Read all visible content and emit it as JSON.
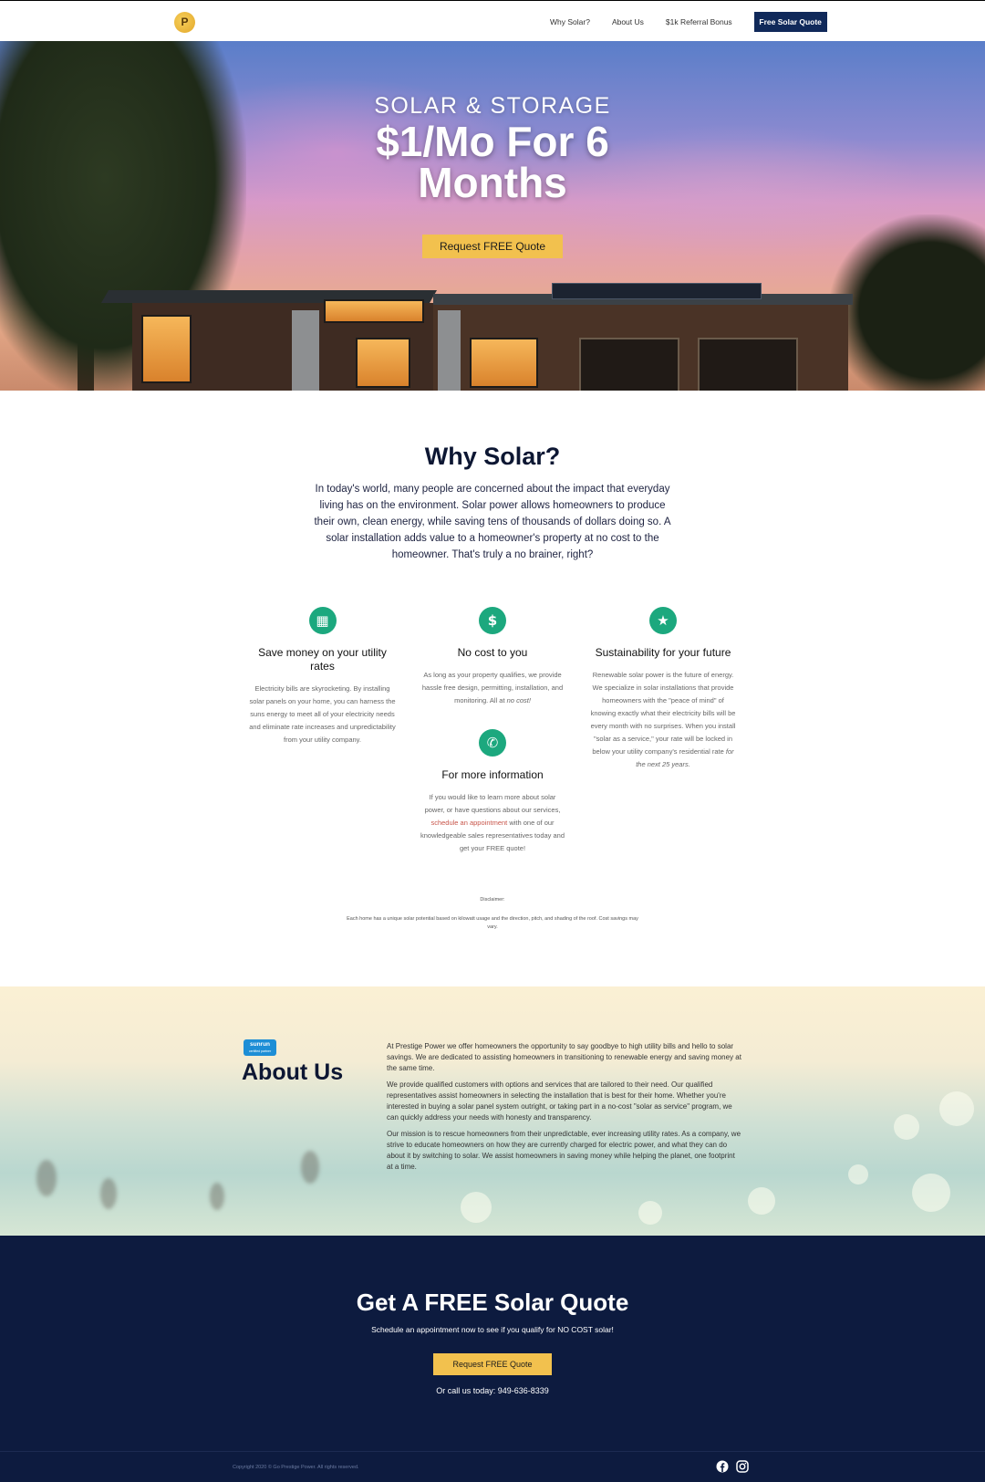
{
  "nav": {
    "logo_letter": "P",
    "links": [
      "Why Solar?",
      "About Us",
      "$1k Referral Bonus"
    ],
    "cta": "Free Solar Quote"
  },
  "hero": {
    "subtitle": "SOLAR & STORAGE",
    "title": "$1/Mo For 6 Months",
    "button": "Request FREE Quote"
  },
  "why": {
    "title": "Why Solar?",
    "text": "In today's world, many people are concerned about the impact that everyday living has on the environment. Solar power allows homeowners to produce their own, clean energy, while saving tens of thousands of dollars doing so. A solar installation adds value to a homeowner's property at no cost to the homeowner. That's truly a no brainer, right?"
  },
  "features": [
    {
      "icon": "solar-panel-icon",
      "title": "Save money on your utility rates",
      "text": "Electricity bills are skyrocketing. By installing solar panels on your home, you can harness the suns energy to meet all of your electricity needs and eliminate rate increases and unpredictability from your utility company."
    },
    {
      "icon": "dollar-icon",
      "title": "No cost to you",
      "text": "As long as your property qualifies, we provide hassle free design, permitting, installation, and monitoring. All at",
      "text_em": "no cost!"
    },
    {
      "icon": "star-icon",
      "title": "Sustainability for your future",
      "text": "Renewable solar power is the future of energy. We specialize in solar installations that provide homeowners with the \"peace of mind\" of knowing exactly what their electricity bills will be every month with no surprises. When you install \"solar as a service,\" your rate will be locked in below your utility company's residential rate",
      "text_em": "for the next 25 years."
    },
    {
      "icon": "phone-icon",
      "title": "For more information",
      "text_before": "If you would like to learn more about solar power, or have questions about our services,",
      "link": "schedule an appointment",
      "text_after": "with one of our knowledgeable sales representatives today and get your FREE quote!"
    }
  ],
  "disclaimer": {
    "label": "Disclaimer:",
    "text": "Each home has a unique solar potential based on kilowatt usage and the direction, pitch, and shading of the roof. Cost savings may vary."
  },
  "about": {
    "badge_line1": "sunrun",
    "badge_line2": "certified partner",
    "title": "About Us",
    "paragraphs": [
      "At Prestige Power we offer homeowners the opportunity to say goodbye to high utility bills and hello to solar savings. We are dedicated to assisting homeowners in transitioning to renewable energy and saving money at the same time.",
      "We provide qualified customers with options and services that are tailored to their need. Our qualified representatives assist homeowners in selecting the installation that is best for their home. Whether you're interested in buying a solar panel system outright, or taking part in a no-cost \"solar as service\" program, we can quickly address your needs with honesty and transparency.",
      "Our mission is to rescue homeowners from their unpredictable, ever increasing utility rates. As a company, we strive to educate homeowners on how they are currently charged for electric power, and what they can do about it by switching to solar. We assist homeowners in saving money while helping the planet, one footprint at a time."
    ]
  },
  "cta": {
    "title": "Get A FREE Solar Quote",
    "subtitle": "Schedule an appointment now to see if you qualify for NO COST solar!",
    "button": "Request FREE Quote",
    "phone": "Or call us today: 949-636-8339"
  },
  "footer": {
    "copyright": "Copyright 2020 © Go Prestige Power. All rights reserved.",
    "social": [
      "facebook-icon",
      "instagram-icon"
    ]
  },
  "colors": {
    "navy": "#0d1b3f",
    "nav_button": "#10295a",
    "accent_yellow": "#f2c14e",
    "icon_green": "#1ca87e",
    "link_red": "#c8554a"
  }
}
